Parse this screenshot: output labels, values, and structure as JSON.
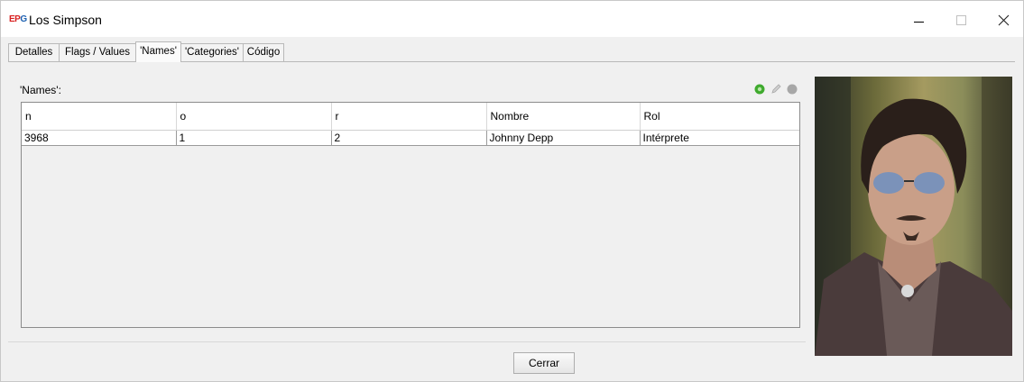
{
  "window": {
    "title": "Los Simpson",
    "icon": "EPG"
  },
  "tabs": [
    {
      "label": "Detalles",
      "active": false
    },
    {
      "label": "Flags / Values",
      "active": false
    },
    {
      "label": "'Names'",
      "active": true
    },
    {
      "label": "'Categories'",
      "active": false
    },
    {
      "label": "Código",
      "active": false
    }
  ],
  "names_panel": {
    "label": "'Names':",
    "toolbar": {
      "add_icon": "add-icon",
      "edit_icon": "pencil-icon",
      "delete_icon": "delete-icon"
    },
    "table": {
      "columns": [
        "n",
        "o",
        "r",
        "Nombre",
        "Rol"
      ],
      "rows": [
        [
          "3968",
          "1",
          "2",
          "Johnny Depp",
          "Intérprete"
        ]
      ]
    }
  },
  "photo": {
    "icon": "person-photo"
  },
  "footer": {
    "close_label": "Cerrar"
  },
  "colors": {
    "add_icon": "#3faa2e",
    "title_icon_red": "#d81e1e",
    "title_icon_blue": "#1b5fb0"
  }
}
